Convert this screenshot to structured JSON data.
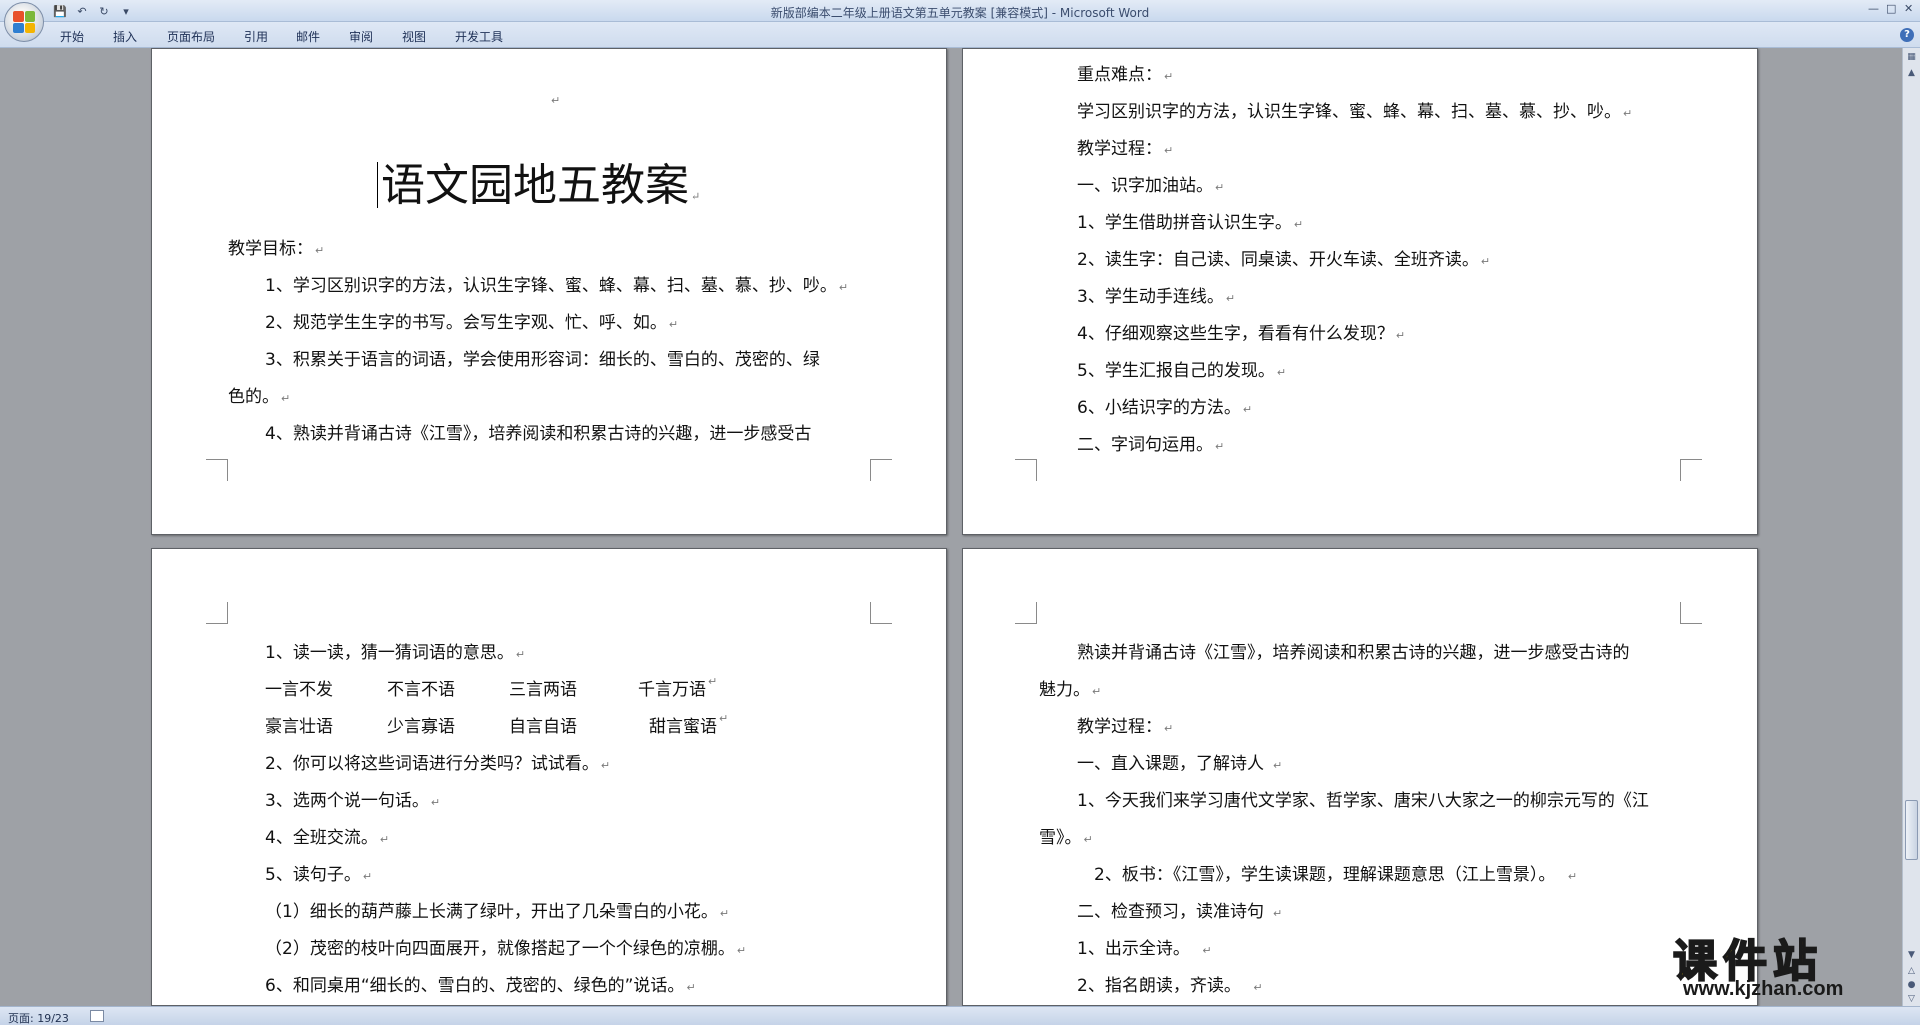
{
  "window": {
    "title": "新版部编本二年级上册语文第五单元教案 [兼容模式] - Microsoft Word",
    "qat": [
      "save-icon",
      "undo-icon",
      "redo-icon",
      "customize-icon"
    ],
    "controls": [
      "minimize",
      "maximize",
      "close"
    ]
  },
  "ribbon": {
    "tabs": [
      "开始",
      "插入",
      "页面布局",
      "引用",
      "邮件",
      "审阅",
      "视图",
      "开发工具"
    ],
    "help": "?"
  },
  "pages": {
    "p1": {
      "title": "语文园地五教案",
      "lines": [
        "教学目标：",
        "1、学习区别识字的方法，认识生字锋、蜜、蜂、幕、扫、墓、慕、抄、吵。",
        "2、规范学生生字的书写。会写生字观、忙、呼、如。",
        "3、积累关于语言的词语，学会使用形容词：细长的、雪白的、茂密的、绿",
        "色的。",
        "4、熟读并背诵古诗《江雪》，培养阅读和积累古诗的兴趣，进一步感受古"
      ]
    },
    "p2": {
      "lines": [
        "重点难点：",
        "学习区别识字的方法，认识生字锋、蜜、蜂、幕、扫、墓、慕、抄、吵。",
        "教学过程：",
        "一、识字加油站。",
        "1、学生借助拼音认识生字。",
        "2、读生字：自己读、同桌读、开火车读、全班齐读。",
        "3、学生动手连线。",
        "4、仔细观察这些生字，看看有什么发现？",
        "5、学生汇报自己的发现。",
        "6、小结识字的方法。",
        "二、字词句运用。"
      ]
    },
    "p3": {
      "lines": [
        "1、读一读，猜一猜词语的意思。",
        "2、你可以将这些词语进行分类吗？试试看。",
        "3、选两个说一句话。",
        "4、全班交流。",
        "5、读句子。",
        "（1）细长的葫芦藤上长满了绿叶，开出了几朵雪白的小花。",
        "（2）茂密的枝叶向四面展开，就像搭起了一个个绿色的凉棚。",
        "6、和同桌用“细长的、雪白的、茂密的、绿色的”说话。"
      ],
      "words_row1": [
        "一言不发",
        "不言不语",
        "三言两语",
        "千言万语"
      ],
      "words_row2": [
        "豪言壮语",
        "少言寡语",
        "自言自语",
        "甜言蜜语"
      ]
    },
    "p4": {
      "lines": [
        "熟读并背诵古诗《江雪》，培养阅读和积累古诗的兴趣，进一步感受古诗的",
        "魅力。",
        "教学过程：",
        "一、直入课题，了解诗人",
        "1、今天我们来学习唐代文学家、哲学家、唐宋八大家之一的柳宗元写的《江",
        "雪》。",
        "2、板书：《江雪》，学生读课题，理解课题意思（江上雪景）。",
        "二、检查预习，读准诗句",
        "1、出示全诗。",
        "2、指名朗读，齐读。"
      ]
    }
  },
  "statusbar": {
    "page_info": "页面: 19/23"
  },
  "watermark": {
    "name": "课件站",
    "url": "www.kjzhan.com"
  }
}
